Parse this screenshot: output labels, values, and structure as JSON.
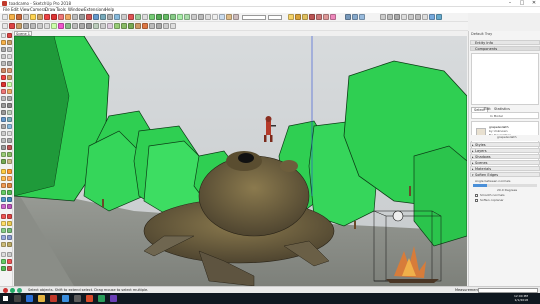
{
  "window": {
    "title": "toadcamo - SketchUp Pro 2018",
    "minimize": "–",
    "maximize": "□",
    "close": "✕"
  },
  "menu": [
    "File",
    "Edit",
    "View",
    "Camera",
    "Draw",
    "Tools",
    "Window",
    "Extensions",
    "Help"
  ],
  "toolbar": {
    "field1_value": "",
    "field2_value": ""
  },
  "scene_tab": "Scene 1",
  "tray": {
    "header": "Default Tray",
    "entity_info": "Entity Info",
    "components": "Components",
    "tabs": [
      "Select",
      "Edit",
      "Statistics"
    ],
    "search_placeholder": "In Model",
    "component_name": "grapeGoliath",
    "component_by": "by Unknown",
    "component_desc": "No Description",
    "panel_label": "grapeGoliath",
    "sections": [
      "Styles",
      "Layers",
      "Shadows",
      "Scenes",
      "Materials",
      "Soften Edges"
    ],
    "soften_label": "Angle between normals",
    "soften_value": "20.0  Degrees",
    "smooth_normals": "Smooth normals",
    "soften_coplanar": "Soften coplanar"
  },
  "status": {
    "text": "Select objects. Shift to extend select. Drag mouse to select multiple.",
    "measurements_label": "Measurements"
  },
  "taskbar": {
    "time": "12:00 PM",
    "date": "1/1/2018"
  },
  "colors": {
    "tree_green": "#2fcf52",
    "tree_dark": "#1f9a3a",
    "toad_brown": "#6b5d3b",
    "ground": "#8d9089",
    "sky": "#d9dcde",
    "accent_red": "#c0392b"
  }
}
